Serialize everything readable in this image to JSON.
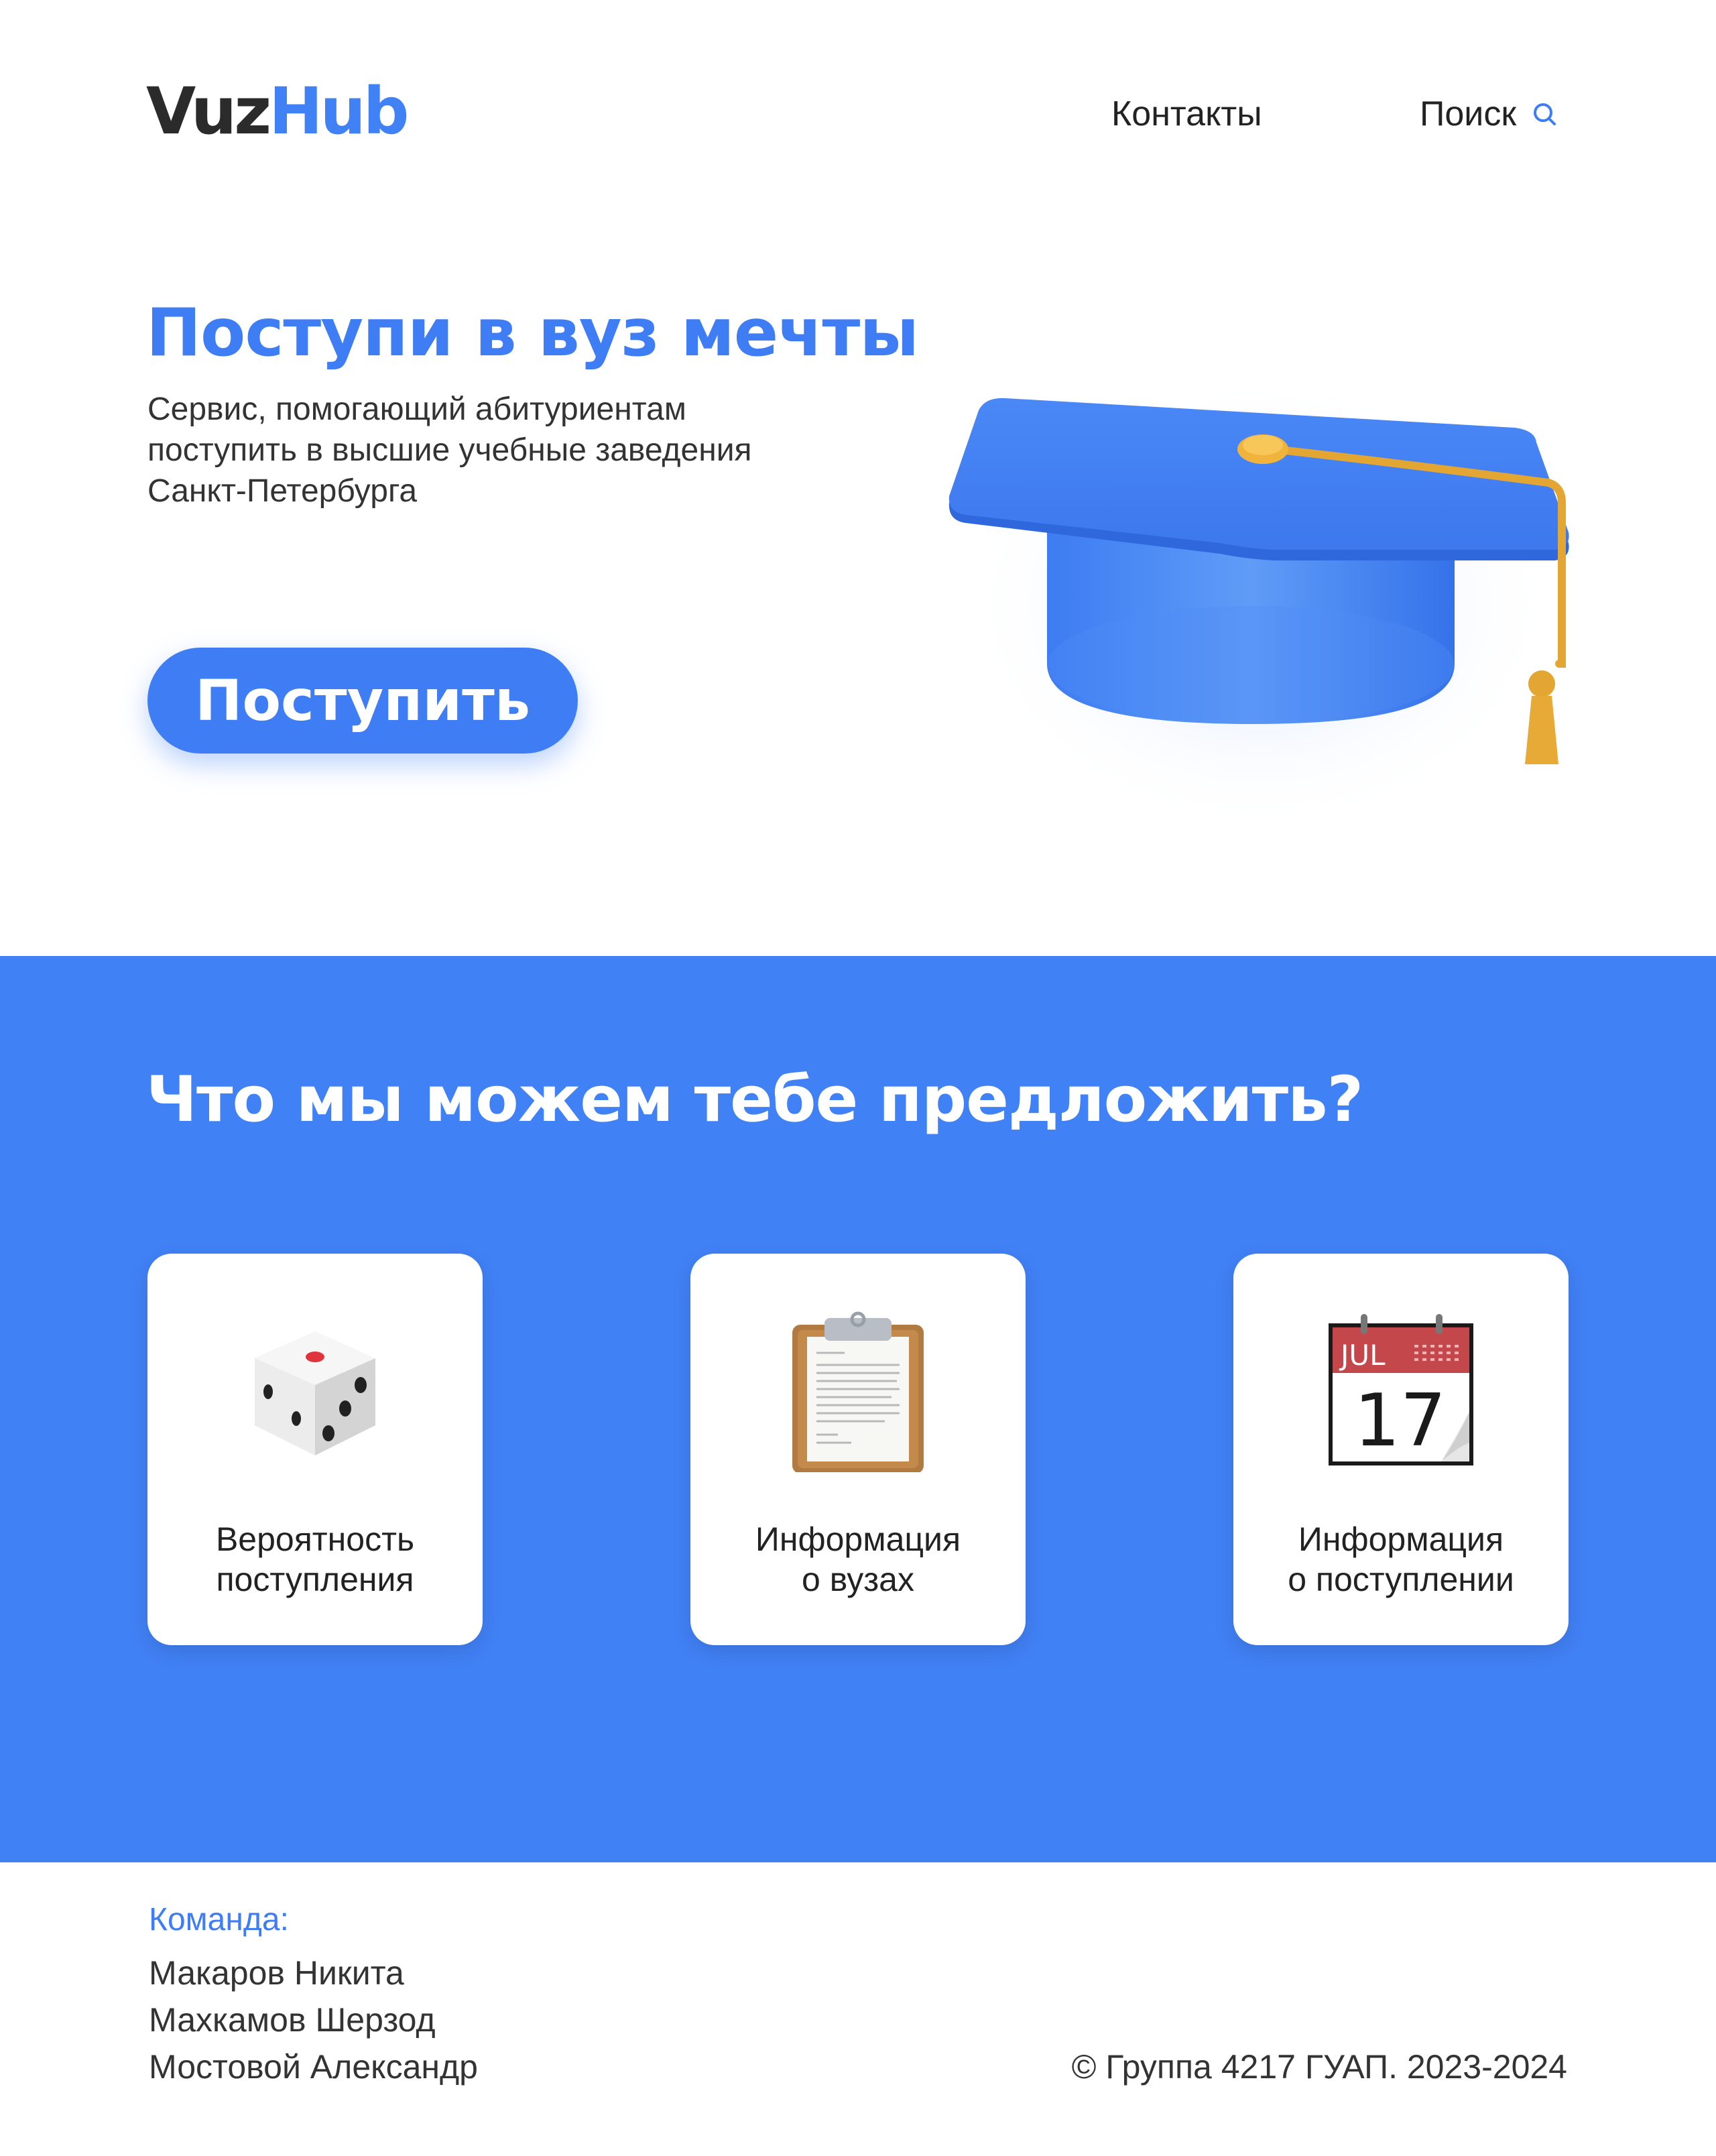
{
  "brand": {
    "logo_part1": "Vuz",
    "logo_part2": "Hub",
    "accent_color": "#4181f6"
  },
  "nav": {
    "contacts": "Контакты",
    "search": "Поиск",
    "search_icon": "search-icon"
  },
  "hero": {
    "title": "Поступи в вуз мечты",
    "subtitle": "Сервис, помогающий абитуриентам поступить в высшие учебные заведения Санкт-Петербурга",
    "cta": "Поступить",
    "image": "graduation-cap-icon"
  },
  "offers": {
    "title": "Что мы можем тебе предложить?",
    "cards": [
      {
        "icon": "dice-icon",
        "line1": "Вероятность",
        "line2": "поступления"
      },
      {
        "icon": "clipboard-icon",
        "line1": "Информация",
        "line2": "о вузах"
      },
      {
        "icon": "calendar-icon",
        "line1": "Информация",
        "line2": "о поступлении",
        "calendar_month": "JUL",
        "calendar_day": "17"
      }
    ]
  },
  "footer": {
    "team_heading": "Команда:",
    "members": [
      "Макаров Никита",
      "Махкамов Шерзод",
      "Мостовой Александр"
    ],
    "copyright": "© Группа 4217 ГУАП. 2023-2024"
  }
}
